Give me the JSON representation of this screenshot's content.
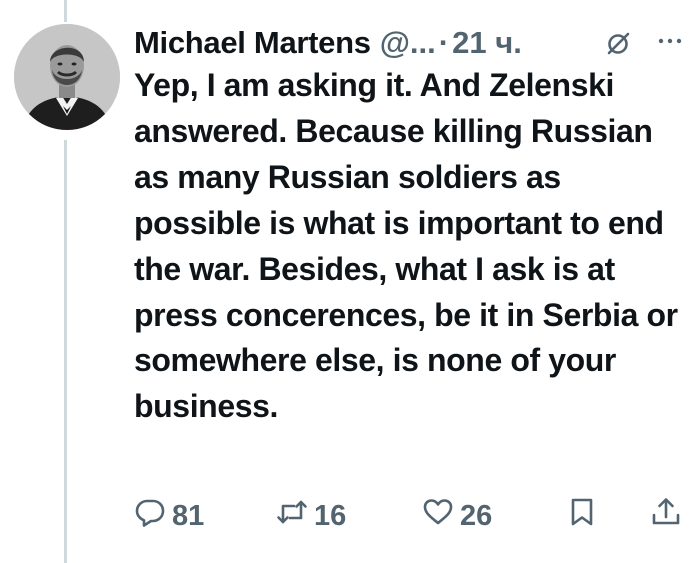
{
  "author": {
    "name": "Michael Martens",
    "handle": "@...",
    "time": "21 ч."
  },
  "header": {
    "separator": "·"
  },
  "tweet": {
    "text": "Yep, I am asking it. And Zelenski answered. Because killing Russian as many Russian soldiers as possible is what is important to end the war. Besides, what I ask is at press concerences, be it in Serbia or somewhere else, is none of your business."
  },
  "actions": {
    "replies": "81",
    "reposts": "16",
    "likes": "26"
  },
  "icons": {
    "reply": "speech-bubble-icon",
    "repost": "repost-arrows-icon",
    "like": "heart-icon",
    "bookmark": "bookmark-icon",
    "share": "share-upload-icon",
    "grok": "grok-slash-circle-icon",
    "more": "more-dots-icon"
  },
  "colors": {
    "text": "#0f1419",
    "secondary": "#536471",
    "thread_line": "#cfd9de"
  }
}
